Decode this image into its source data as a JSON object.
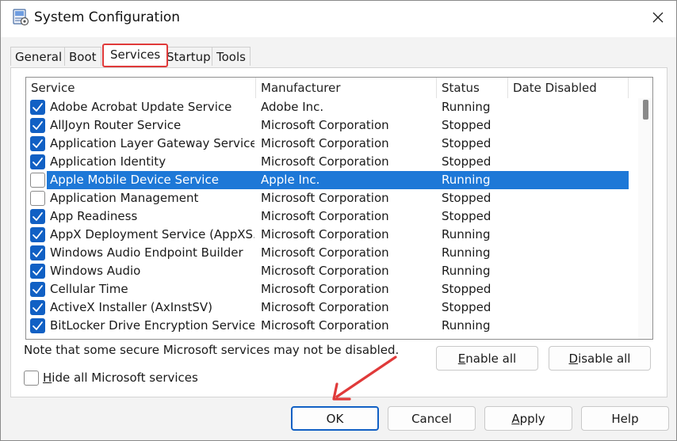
{
  "window": {
    "title": "System Configuration",
    "close_glyph": "✕",
    "app_icon": "system-configuration-icon"
  },
  "tabs": [
    {
      "label": "General",
      "active": false
    },
    {
      "label": "Boot",
      "active": false
    },
    {
      "label": "Services",
      "active": true
    },
    {
      "label": "Startup",
      "active": false
    },
    {
      "label": "Tools",
      "active": false
    }
  ],
  "list": {
    "columns": [
      "Service",
      "Manufacturer",
      "Status",
      "Date Disabled"
    ],
    "rows": [
      {
        "checked": true,
        "service": "Adobe Acrobat Update Service",
        "manufacturer": "Adobe Inc.",
        "status": "Running",
        "date": "",
        "selected": false
      },
      {
        "checked": true,
        "service": "AllJoyn Router Service",
        "manufacturer": "Microsoft Corporation",
        "status": "Stopped",
        "date": "",
        "selected": false
      },
      {
        "checked": true,
        "service": "Application Layer Gateway Service",
        "manufacturer": "Microsoft Corporation",
        "status": "Stopped",
        "date": "",
        "selected": false
      },
      {
        "checked": true,
        "service": "Application Identity",
        "manufacturer": "Microsoft Corporation",
        "status": "Stopped",
        "date": "",
        "selected": false
      },
      {
        "checked": false,
        "service": "Apple Mobile Device Service",
        "manufacturer": "Apple Inc.",
        "status": "Running",
        "date": "",
        "selected": true
      },
      {
        "checked": false,
        "service": "Application Management",
        "manufacturer": "Microsoft Corporation",
        "status": "Stopped",
        "date": "",
        "selected": false
      },
      {
        "checked": true,
        "service": "App Readiness",
        "manufacturer": "Microsoft Corporation",
        "status": "Stopped",
        "date": "",
        "selected": false
      },
      {
        "checked": true,
        "service": "AppX Deployment Service (AppXS...",
        "manufacturer": "Microsoft Corporation",
        "status": "Running",
        "date": "",
        "selected": false
      },
      {
        "checked": true,
        "service": "Windows Audio Endpoint Builder",
        "manufacturer": "Microsoft Corporation",
        "status": "Running",
        "date": "",
        "selected": false
      },
      {
        "checked": true,
        "service": "Windows Audio",
        "manufacturer": "Microsoft Corporation",
        "status": "Running",
        "date": "",
        "selected": false
      },
      {
        "checked": true,
        "service": "Cellular Time",
        "manufacturer": "Microsoft Corporation",
        "status": "Stopped",
        "date": "",
        "selected": false
      },
      {
        "checked": true,
        "service": "ActiveX Installer (AxInstSV)",
        "manufacturer": "Microsoft Corporation",
        "status": "Stopped",
        "date": "",
        "selected": false
      },
      {
        "checked": true,
        "service": "BitLocker Drive Encryption Service",
        "manufacturer": "Microsoft Corporation",
        "status": "Running",
        "date": "",
        "selected": false
      }
    ]
  },
  "note": "Note that some secure Microsoft services may not be disabled.",
  "enable_all": {
    "hotkey": "E",
    "rest": "nable all"
  },
  "disable_all": {
    "hotkey": "D",
    "rest": "isable all"
  },
  "hide_ms": {
    "hotkey": "H",
    "rest": "ide all Microsoft services",
    "checked": false
  },
  "footer": {
    "ok": "OK",
    "cancel": "Cancel",
    "apply": {
      "hotkey": "A",
      "rest": "pply"
    },
    "help": "Help"
  },
  "colors": {
    "selection": "#1e78d7",
    "checkbox": "#1160c4",
    "annotation": "#e03a3a"
  }
}
